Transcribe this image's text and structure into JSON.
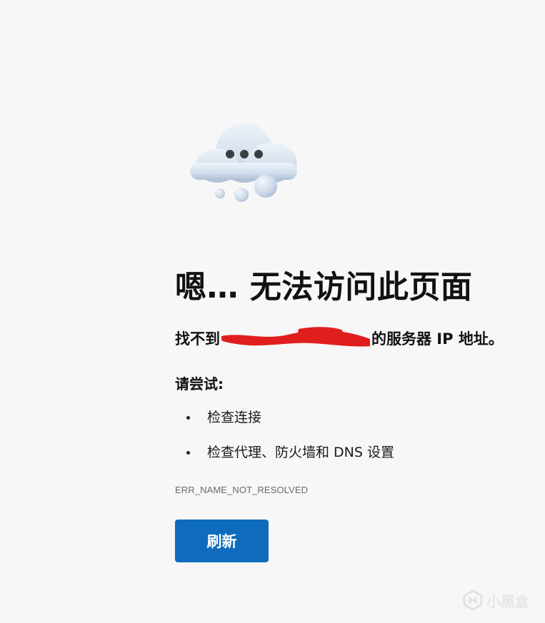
{
  "error_page": {
    "illustration": "cloud-with-dots-icon",
    "title": "嗯… 无法访问此页面",
    "subtitle_prefix": "找不到",
    "subtitle_suffix": "的服务器 IP 地址。",
    "try_label": "请尝试:",
    "suggestions": [
      "检查连接",
      "检查代理、防火墙和 DNS 设置"
    ],
    "error_code": "ERR_NAME_NOT_RESOLVED",
    "refresh_label": "刷新"
  },
  "colors": {
    "background": "#f7f7f7",
    "button": "#0f6cbd",
    "redaction": "#e01e1e"
  },
  "watermark": {
    "text": "小黑盒",
    "icon": "heybox-logo-icon"
  }
}
